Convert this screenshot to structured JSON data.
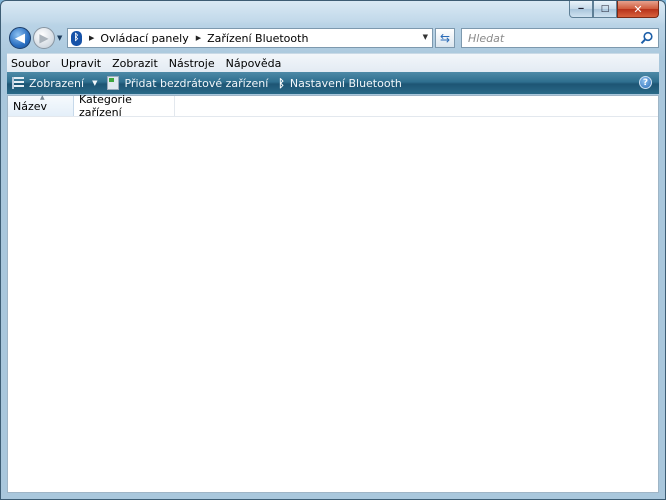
{
  "window": {
    "controls": {
      "minimize": "‒",
      "maximize": "□",
      "close": "✕"
    }
  },
  "nav": {
    "back_glyph": "◀",
    "forward_glyph": "▶",
    "breadcrumb": [
      "Ovládací panely",
      "Zařízení Bluetooth"
    ],
    "search_placeholder": "Hledat"
  },
  "menu": [
    "Soubor",
    "Upravit",
    "Zobrazit",
    "Nástroje",
    "Nápověda"
  ],
  "commands": {
    "views": "Zobrazení",
    "add_device": "Přidat bezdrátové zařízení",
    "bt_settings": "Nastavení Bluetooth",
    "help": "?"
  },
  "columns": [
    "Název",
    "Kategorie zařízení"
  ],
  "icons": {
    "bluetooth": "bluetooth-icon",
    "search": "magnifier-icon",
    "refresh": "refresh-icon",
    "help": "help-icon"
  }
}
